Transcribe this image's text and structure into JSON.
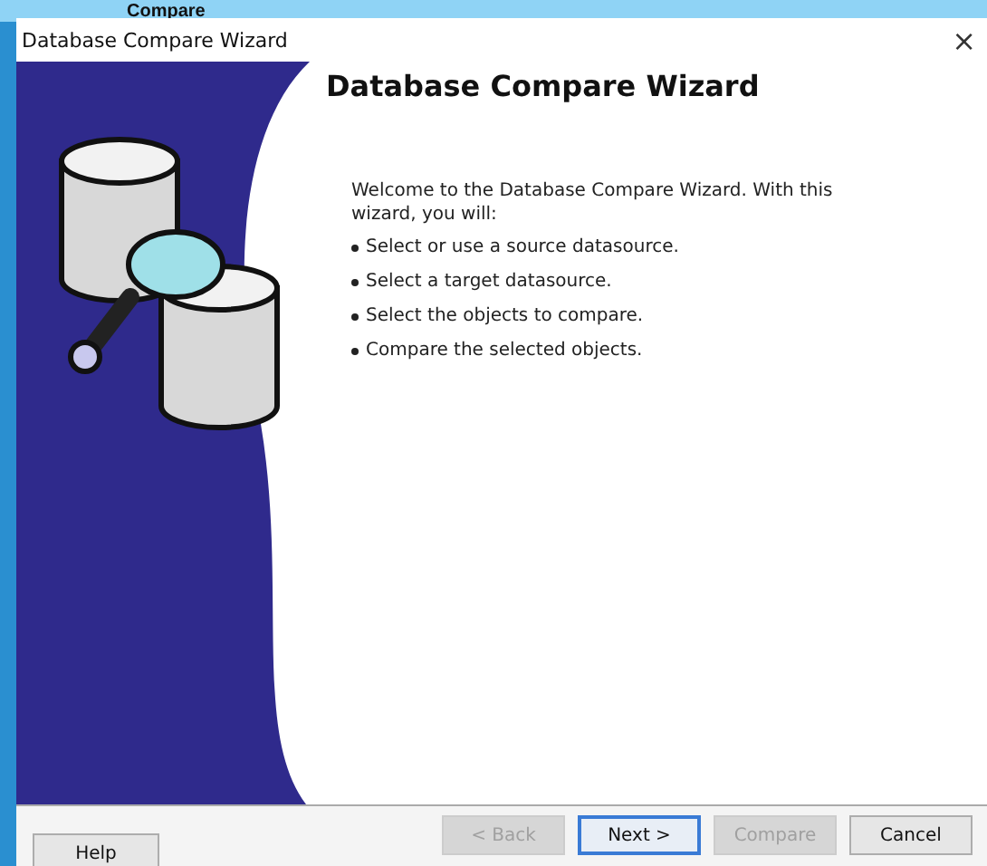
{
  "background_window": {
    "title": "Compare"
  },
  "window": {
    "title": "Database Compare Wizard",
    "close": "×"
  },
  "heading": "Database Compare Wizard",
  "intro": "Welcome to the Database Compare Wizard. With this wizard, you will:",
  "bullets": [
    "Select or use a source datasource.",
    "Select a target datasource.",
    "Select the objects to compare.",
    "Compare the selected objects."
  ],
  "buttons": [
    {
      "label": "Help",
      "kind": "help",
      "disabled": false,
      "selected": false
    },
    {
      "label": "< Back",
      "kind": "nav",
      "disabled": true,
      "selected": false
    },
    {
      "label": "Next >",
      "kind": "nav",
      "disabled": false,
      "selected": true
    },
    {
      "label": "Compare",
      "kind": "nav",
      "disabled": true,
      "selected": false
    },
    {
      "label": "Cancel",
      "kind": "nav",
      "disabled": false,
      "selected": false
    }
  ]
}
